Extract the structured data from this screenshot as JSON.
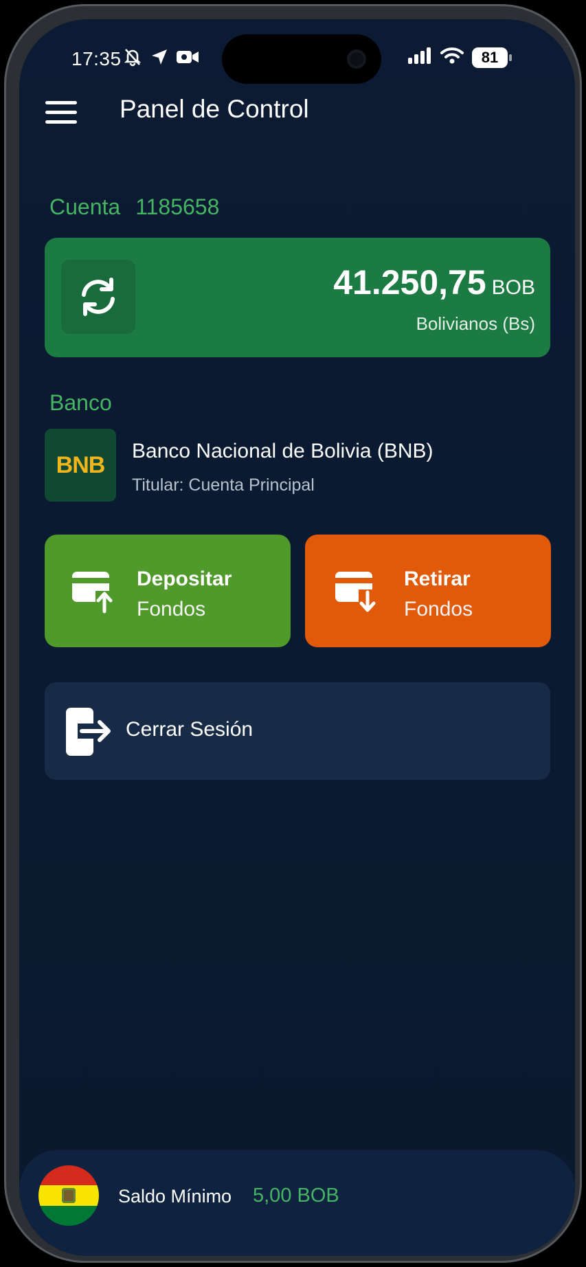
{
  "status_bar": {
    "time": "17:35",
    "battery": "81",
    "icons_left": [
      "bell-slash-icon",
      "location-arrow-icon",
      "video-camera-icon"
    ],
    "icons_right": [
      "cellular-signal-icon",
      "wifi-icon",
      "battery-icon"
    ]
  },
  "header": {
    "title": "Panel de Control",
    "menu_icon": "hamburger-menu-icon"
  },
  "account": {
    "label": "Cuenta",
    "number": "1185658"
  },
  "balance": {
    "amount": "41.250,75",
    "currency": "BOB",
    "currency_name": "Bolivianos (Bs)",
    "refresh_icon": "refresh-icon"
  },
  "bank": {
    "section_label": "Banco",
    "logo_text": "BNB",
    "name": "Banco Nacional de Bolivia (BNB)",
    "holder": "Titular: Cuenta Principal"
  },
  "actions": {
    "deposit": {
      "line1": "Depositar",
      "line2": "Fondos",
      "icon": "card-deposit-icon"
    },
    "withdraw": {
      "line1": "Retirar",
      "line2": "Fondos",
      "icon": "card-withdraw-icon"
    }
  },
  "logout": {
    "label": "Cerrar Sesión",
    "icon": "logout-icon"
  },
  "footer": {
    "label": "Saldo Mínimo",
    "value": "5,00 BOB",
    "flag_icon": "bolivia-flag-icon"
  },
  "colors": {
    "background": "#0c1b33",
    "accent_green": "#45b563",
    "balance_card": "#1c7a43",
    "deposit": "#4f9a2a",
    "withdraw": "#e05a0a",
    "logout_card": "#172a46"
  }
}
